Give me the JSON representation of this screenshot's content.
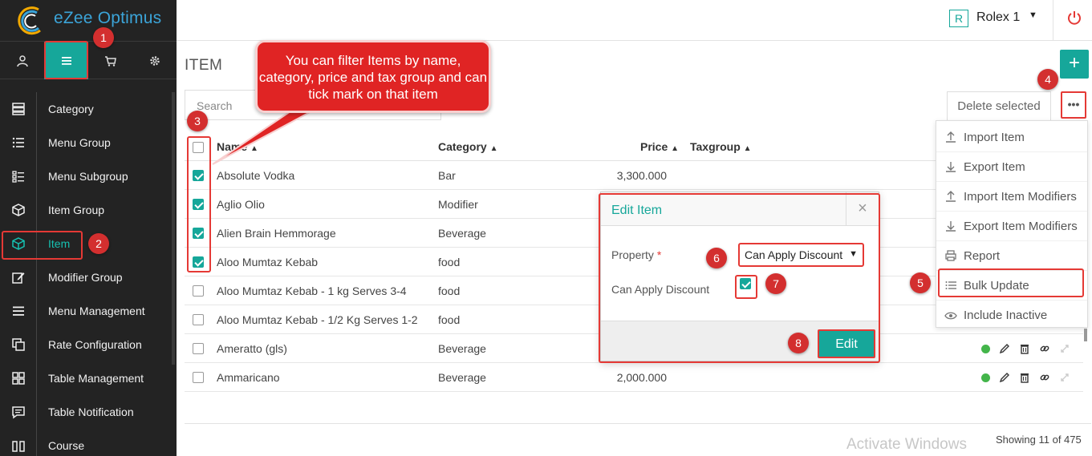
{
  "app": {
    "name": "eZee Optimus"
  },
  "topbar": {
    "outlet_badge": "R",
    "outlet_name": "Rolex 1"
  },
  "sidebar": {
    "tabs": [
      {
        "icon": "user-icon"
      },
      {
        "icon": "hamburger-menu-icon",
        "active": true
      },
      {
        "icon": "cart-icon"
      },
      {
        "icon": "gear-icon"
      }
    ],
    "items": [
      {
        "label": "Category",
        "icon": "category-icon"
      },
      {
        "label": "Menu Group",
        "icon": "list-icon"
      },
      {
        "label": "Menu Subgroup",
        "icon": "sublist-icon"
      },
      {
        "label": "Item Group",
        "icon": "box-icon"
      },
      {
        "label": "Item",
        "icon": "cube-icon",
        "active": true
      },
      {
        "label": "Modifier Group",
        "icon": "edit-icon"
      },
      {
        "label": "Menu Management",
        "icon": "menu-icon"
      },
      {
        "label": "Rate Configuration",
        "icon": "copy-icon"
      },
      {
        "label": "Table Management",
        "icon": "grid-icon"
      },
      {
        "label": "Table Notification",
        "icon": "chat-icon"
      },
      {
        "label": "Course",
        "icon": "book-icon"
      }
    ]
  },
  "main": {
    "title": "ITEM",
    "add_label": "+",
    "search_placeholder": "Search",
    "delete_selected": "Delete selected",
    "more_label": "•••",
    "columns": {
      "name": "Name",
      "category": "Category",
      "price": "Price",
      "taxgroup": "Taxgroup",
      "sort_glyph": "▲"
    },
    "rows": [
      {
        "name": "Absolute Vodka",
        "category": "Bar",
        "price": "3,300.000",
        "checked": true
      },
      {
        "name": "Aglio Olio",
        "category": "Modifier",
        "price": "",
        "checked": true
      },
      {
        "name": "Alien Brain Hemmorage",
        "category": "Beverage",
        "price": "",
        "checked": true
      },
      {
        "name": "Aloo Mumtaz Kebab",
        "category": "food",
        "price": "",
        "checked": true
      },
      {
        "name": "Aloo Mumtaz Kebab - 1 kg Serves 3-4",
        "category": "food",
        "price": "",
        "checked": false
      },
      {
        "name": "Aloo Mumtaz Kebab - 1/2 Kg Serves 1-2",
        "category": "food",
        "price": "",
        "checked": false
      },
      {
        "name": "Ameratto (gls)",
        "category": "Beverage",
        "price": "",
        "checked": false
      },
      {
        "name": "Ammaricano",
        "category": "Beverage",
        "price": "2,000.000",
        "checked": false
      }
    ],
    "showing": "Showing 11 of 475",
    "watermark": "Activate Windows"
  },
  "dropdown": {
    "items": [
      {
        "label": "Import Item",
        "icon": "upload-icon"
      },
      {
        "label": "Export Item",
        "icon": "download-icon"
      },
      {
        "label": "Import Item Modifiers",
        "icon": "upload-icon"
      },
      {
        "label": "Export Item Modifiers",
        "icon": "download-icon"
      },
      {
        "label": "Report",
        "icon": "print-icon"
      },
      {
        "label": "Bulk Update",
        "icon": "bulk-list-icon"
      },
      {
        "label": "Include Inactive",
        "icon": "eye-icon"
      }
    ]
  },
  "modal": {
    "title": "Edit Item",
    "close_label": "×",
    "property_label": "Property",
    "required_mark": "*",
    "property_value": "Can Apply Discount",
    "discount_label": "Can Apply Discount",
    "discount_checked": true,
    "edit_label": "Edit"
  },
  "annotations": {
    "callout_text": "You can filter Items by name, category, price and tax group and can tick mark on that item",
    "steps": [
      "1",
      "2",
      "3",
      "4",
      "5",
      "6",
      "7",
      "8"
    ]
  },
  "colors": {
    "accent": "#16a79a",
    "annotation_red": "#e53935",
    "sidebar_bg": "#232323"
  }
}
